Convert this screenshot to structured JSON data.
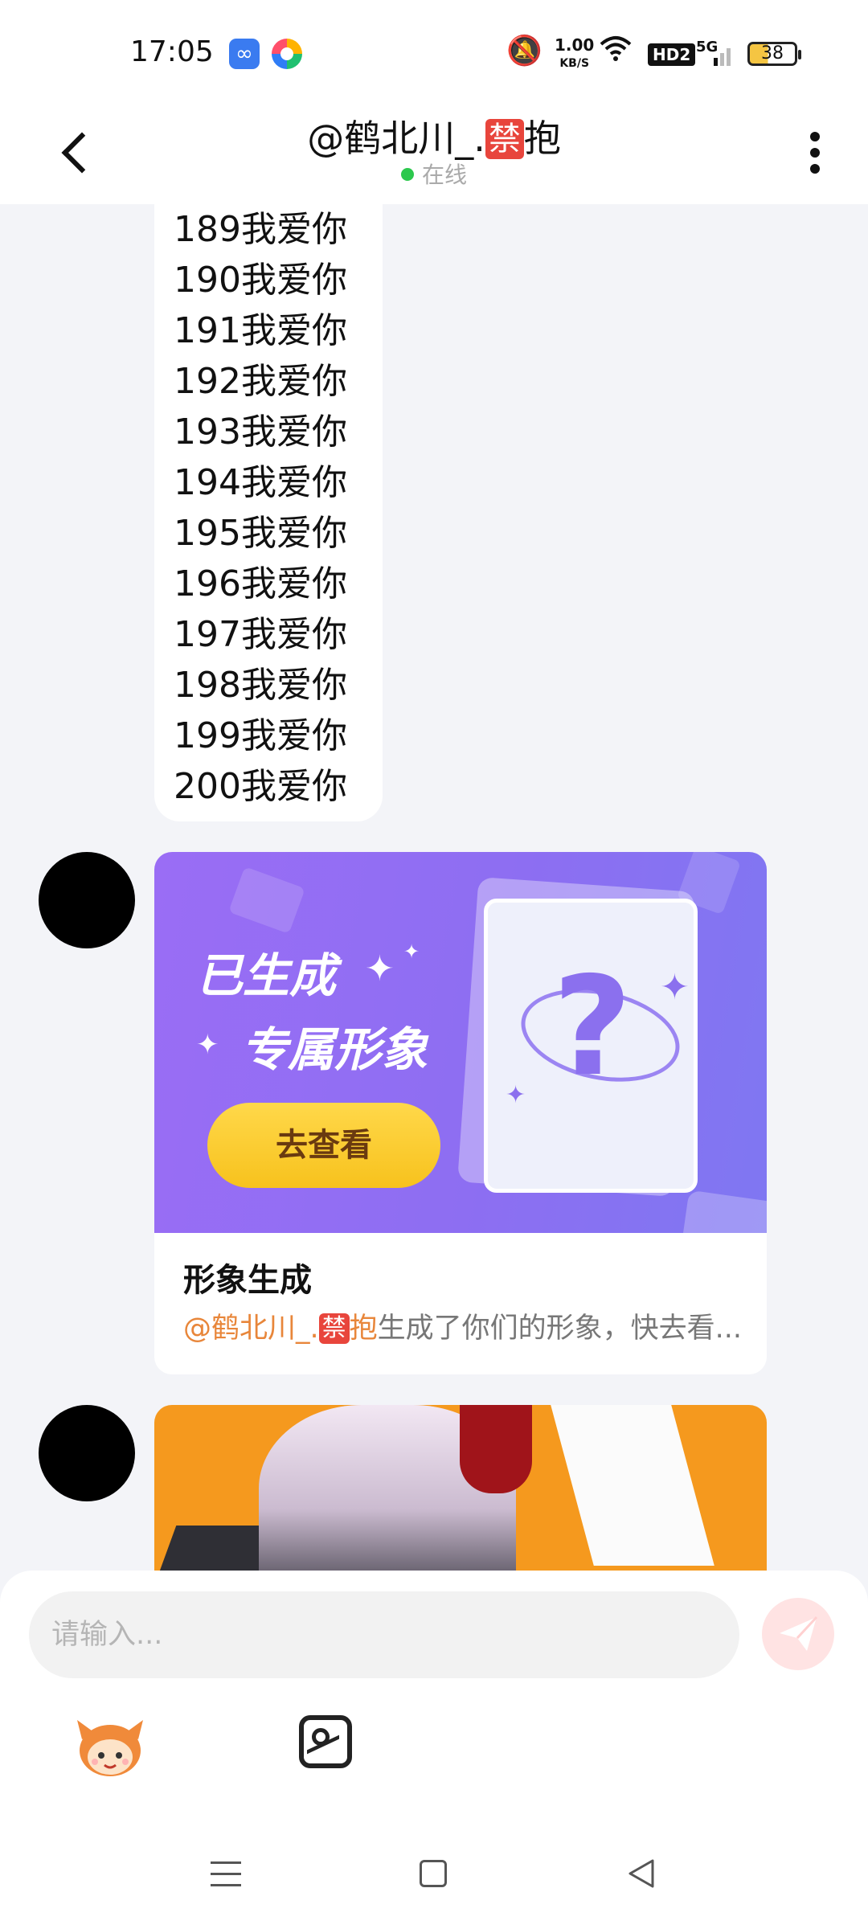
{
  "status_bar": {
    "time": "17:05",
    "net_speed_value": "1.00",
    "net_speed_unit": "KB/S",
    "hd_label": "HD2",
    "signal_label": "5G",
    "battery": "38"
  },
  "header": {
    "title_prefix": "@鹤北川_.",
    "title_badge": "禁",
    "title_suffix": "抱",
    "status": "在线"
  },
  "messages": {
    "love_lines": [
      "189我爱你",
      "190我爱你",
      "191我爱你",
      "192我爱你",
      "193我爱你",
      "194我爱你",
      "195我爱你",
      "196我爱你",
      "197我爱你",
      "198我爱你",
      "199我爱你",
      "200我爱你"
    ]
  },
  "card": {
    "banner_line1": "已生成",
    "banner_line2": "专属形象",
    "button_label": "去查看",
    "question_mark": "?",
    "title": "形象生成",
    "desc_mention_prefix": "@鹤北川_.",
    "desc_mention_badge": "禁",
    "desc_mention_suffix": "抱",
    "desc_text": "生成了你们的形象，快去看..."
  },
  "input": {
    "placeholder": "请输入..."
  },
  "colors": {
    "accent_orange": "#e8863a",
    "online_green": "#2cc84d",
    "banner_purple": "#9a6df5",
    "button_yellow": "#f7c21d"
  },
  "icons": {
    "back": "chevron-left-icon",
    "more": "more-vertical-icon",
    "send": "send-icon",
    "mascot": "mascot-icon",
    "image": "image-icon"
  }
}
